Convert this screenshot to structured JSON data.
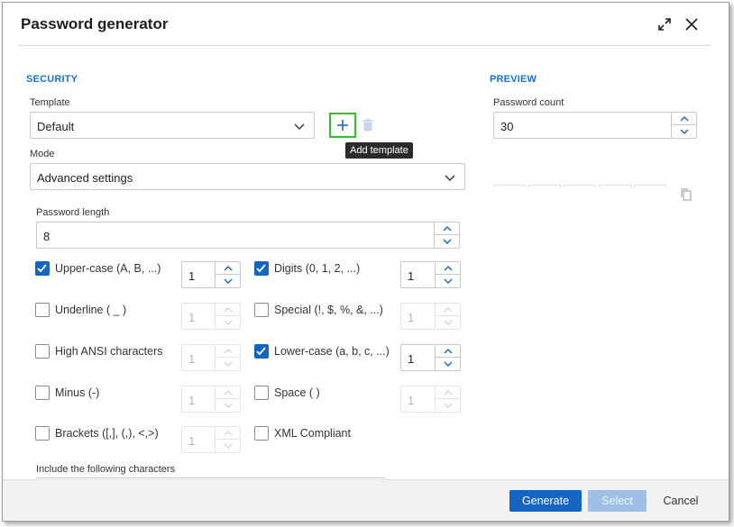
{
  "dialog": {
    "title": "Password generator"
  },
  "security": {
    "heading": "SECURITY",
    "template_label": "Template",
    "template_value": "Default",
    "add_tooltip": "Add template",
    "mode_label": "Mode",
    "mode_value": "Advanced settings",
    "length_label": "Password length",
    "length_value": "8",
    "options": {
      "upper": {
        "label": "Upper-case (A, B, ...)",
        "checked": true,
        "count": "1"
      },
      "digits": {
        "label": "Digits (0, 1, 2, ...)",
        "checked": true,
        "count": "1"
      },
      "underline": {
        "label": "Underline ( _ )",
        "checked": false,
        "count": "1"
      },
      "special": {
        "label": "Special (!, $, %, &, ...)",
        "checked": false,
        "count": "1"
      },
      "high_ansi": {
        "label": "High ANSI characters",
        "checked": false,
        "count": "1"
      },
      "lower": {
        "label": "Lower-case (a, b, c, ...)",
        "checked": true,
        "count": "1"
      },
      "minus": {
        "label": "Minus (-)",
        "checked": false,
        "count": "1"
      },
      "space": {
        "label": "Space ( )",
        "checked": false,
        "count": "1"
      },
      "brackets": {
        "label": "Brackets ([,], (,), <,>)",
        "checked": false,
        "count": "1"
      },
      "xml": {
        "label": "XML Compliant",
        "checked": false
      }
    },
    "include_label": "Include the following characters"
  },
  "preview": {
    "heading": "PREVIEW",
    "count_label": "Password count",
    "count_value": "30"
  },
  "footer": {
    "generate": "Generate",
    "select": "Select",
    "cancel": "Cancel"
  },
  "colors": {
    "accent": "#1565c0",
    "section": "#1a73c7",
    "highlight": "#2fc02f"
  }
}
